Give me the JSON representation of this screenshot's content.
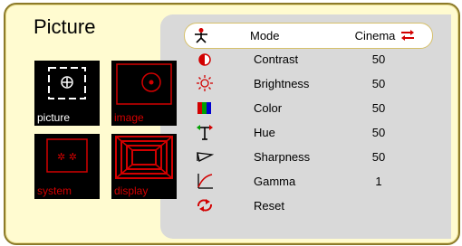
{
  "title": "Picture",
  "tiles": [
    {
      "label": "picture",
      "label_color": "#ffffff",
      "icon": "picture-icon"
    },
    {
      "label": "image",
      "label_color": "#d20000",
      "icon": "image-icon"
    },
    {
      "label": "system",
      "label_color": "#d20000",
      "icon": "system-icon"
    },
    {
      "label": "display",
      "label_color": "#d20000",
      "icon": "display-icon"
    }
  ],
  "menu": [
    {
      "label": "Mode",
      "value": "Cinema",
      "icon": "mode-person-icon",
      "selected": true
    },
    {
      "label": "Contrast",
      "value": "50",
      "icon": "contrast-icon"
    },
    {
      "label": "Brightness",
      "value": "50",
      "icon": "brightness-icon"
    },
    {
      "label": "Color",
      "value": "50",
      "icon": "color-icon"
    },
    {
      "label": "Hue",
      "value": "50",
      "icon": "hue-icon"
    },
    {
      "label": "Sharpness",
      "value": "50",
      "icon": "sharpness-icon"
    },
    {
      "label": "Gamma",
      "value": "1",
      "icon": "gamma-icon"
    },
    {
      "label": "Reset",
      "value": "",
      "icon": "reset-icon"
    }
  ],
  "colors": {
    "frame_bg": "#fffbd0",
    "frame_border": "#8c7a2a",
    "panel_bg": "#d9d9d9",
    "accent_red": "#d20000"
  }
}
